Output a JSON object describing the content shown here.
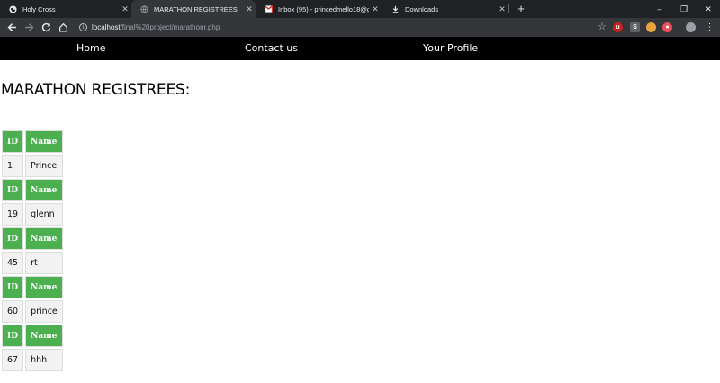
{
  "browser": {
    "tabs": [
      {
        "title": "Holy Cross",
        "icon": "globe-icon",
        "active": false
      },
      {
        "title": "MARATHON REGISTREES",
        "icon": "globe-icon",
        "active": true
      },
      {
        "title": "Inbox (95) - princedmello18@gm",
        "icon": "gmail-icon",
        "active": false
      },
      {
        "title": "Downloads",
        "icon": "download-icon",
        "active": false
      }
    ],
    "new_tab": "+",
    "window_controls": {
      "minimize": "–",
      "restore": "❐",
      "close": "✕"
    },
    "url_host": "localhost",
    "url_path": "/final%20project/marathonr.php"
  },
  "site_nav": {
    "home": "Home",
    "contact": "Contact us",
    "profile": "Your Profile"
  },
  "page": {
    "title": "MARATHON REGISTREES:",
    "headers": {
      "id": "ID",
      "name": "Name"
    },
    "registrees": [
      {
        "id": "1",
        "name": "Prince"
      },
      {
        "id": "19",
        "name": "glenn"
      },
      {
        "id": "45",
        "name": "rt"
      },
      {
        "id": "60",
        "name": "prince"
      },
      {
        "id": "67",
        "name": "hhh"
      }
    ]
  },
  "colors": {
    "header_green": "#4caf50",
    "nav_black": "#000000",
    "cell_grey": "#f2f2f2"
  }
}
